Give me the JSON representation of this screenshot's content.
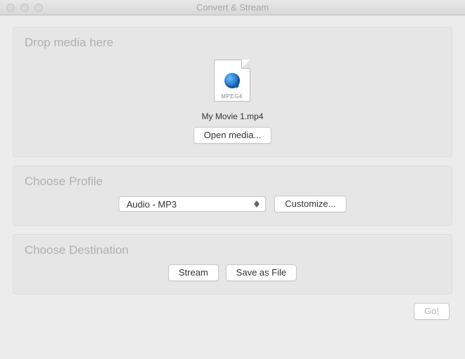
{
  "window": {
    "title": "Convert & Stream"
  },
  "drop": {
    "title": "Drop media here",
    "file_format_label": "MPEG4",
    "filename": "My Movie 1.mp4",
    "open_button": "Open media..."
  },
  "profile": {
    "title": "Choose Profile",
    "selected": "Audio - MP3",
    "customize_button": "Customize..."
  },
  "destination": {
    "title": "Choose Destination",
    "stream_button": "Stream",
    "save_button": "Save as File"
  },
  "footer": {
    "go_button": "Go!"
  }
}
